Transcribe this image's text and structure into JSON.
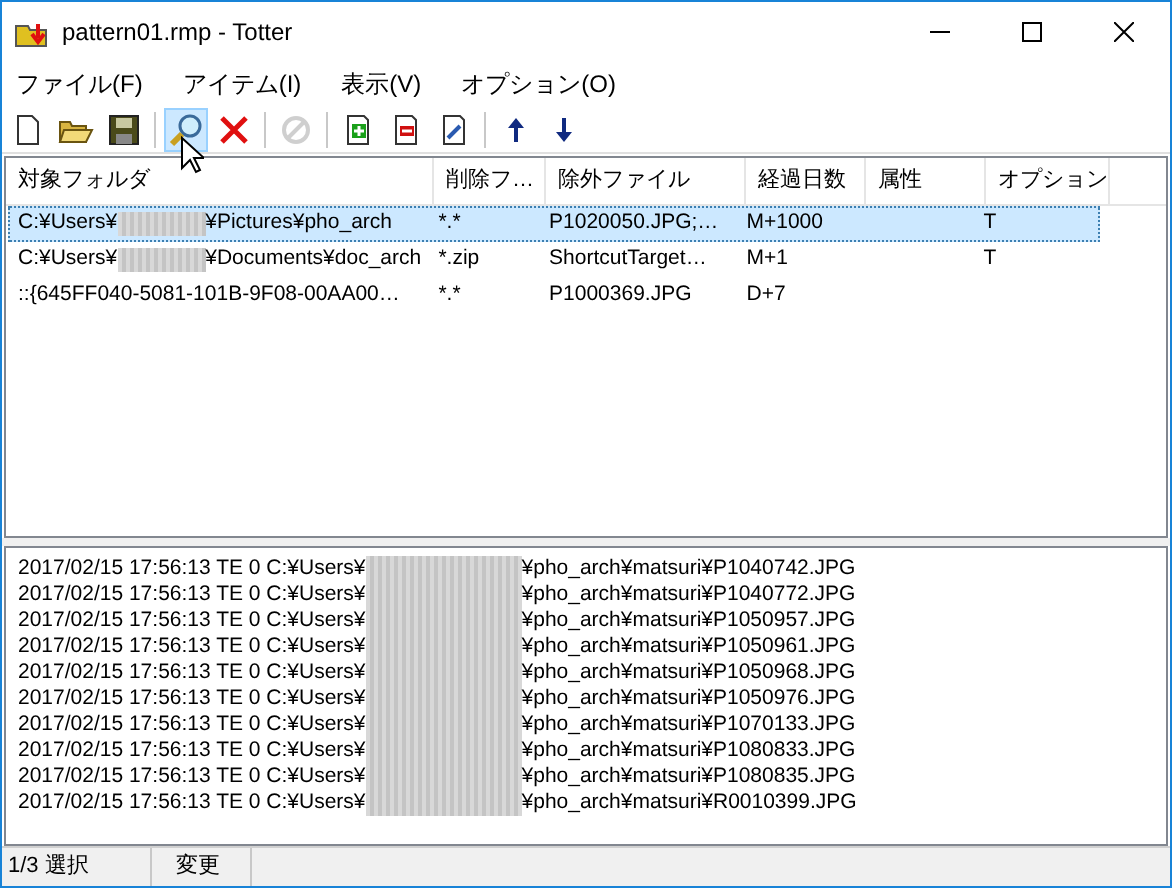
{
  "window": {
    "title": "pattern01.rmp - Totter"
  },
  "menu": [
    "ファイル(F)",
    "アイテム(I)",
    "表示(V)",
    "オプション(O)"
  ],
  "toolbar": [
    [
      {
        "kind": "new",
        "pressed": false,
        "disabled": false
      },
      {
        "kind": "open",
        "pressed": false,
        "disabled": false
      },
      {
        "kind": "save",
        "pressed": false,
        "disabled": false
      }
    ],
    [
      {
        "kind": "search",
        "pressed": true,
        "disabled": false
      },
      {
        "kind": "delete",
        "pressed": false,
        "disabled": false
      }
    ],
    [
      {
        "kind": "stop",
        "pressed": false,
        "disabled": true
      }
    ],
    [
      {
        "kind": "add",
        "pressed": false,
        "disabled": false
      },
      {
        "kind": "remove",
        "pressed": false,
        "disabled": false
      },
      {
        "kind": "edit",
        "pressed": false,
        "disabled": false
      }
    ],
    [
      {
        "kind": "up",
        "pressed": false,
        "disabled": false
      },
      {
        "kind": "down",
        "pressed": false,
        "disabled": false
      }
    ]
  ],
  "table": {
    "columns": [
      "対象フォルダ",
      "削除フ…",
      "除外ファイル",
      "経過日数",
      "属性",
      "オプション"
    ],
    "rows": [
      {
        "selected": true,
        "cells": [
          [
            "C:¥Users¥",
            "¥Pictures¥pho_arch"
          ],
          "*.*",
          "P1020050.JPG;…",
          "M+1000",
          "",
          "T"
        ]
      },
      {
        "selected": false,
        "cells": [
          [
            "C:¥Users¥",
            "¥Documents¥doc_arch"
          ],
          "*.zip",
          "ShortcutTarget…",
          "M+1",
          "",
          "T"
        ]
      },
      {
        "selected": false,
        "cells": [
          "::{645FF040-5081-101B-9F08-00AA00…",
          "*.*",
          "P1000369.JPG",
          "D+7",
          "",
          ""
        ]
      }
    ]
  },
  "log": [
    [
      "2017/02/15 17:56:13 TE 0 C:¥Users¥",
      "¥pho_arch¥matsuri¥P1040742.JPG"
    ],
    [
      "2017/02/15 17:56:13 TE 0 C:¥Users¥",
      "¥pho_arch¥matsuri¥P1040772.JPG"
    ],
    [
      "2017/02/15 17:56:13 TE 0 C:¥Users¥",
      "¥pho_arch¥matsuri¥P1050957.JPG"
    ],
    [
      "2017/02/15 17:56:13 TE 0 C:¥Users¥",
      "¥pho_arch¥matsuri¥P1050961.JPG"
    ],
    [
      "2017/02/15 17:56:13 TE 0 C:¥Users¥",
      "¥pho_arch¥matsuri¥P1050968.JPG"
    ],
    [
      "2017/02/15 17:56:13 TE 0 C:¥Users¥",
      "¥pho_arch¥matsuri¥P1050976.JPG"
    ],
    [
      "2017/02/15 17:56:13 TE 0 C:¥Users¥",
      "¥pho_arch¥matsuri¥P1070133.JPG"
    ],
    [
      "2017/02/15 17:56:13 TE 0 C:¥Users¥",
      "¥pho_arch¥matsuri¥P1080833.JPG"
    ],
    [
      "2017/02/15 17:56:13 TE 0 C:¥Users¥",
      "¥pho_arch¥matsuri¥P1080835.JPG"
    ],
    [
      "2017/02/15 17:56:13 TE 0 C:¥Users¥",
      "¥pho_arch¥matsuri¥R0010399.JPG"
    ]
  ],
  "status_bar": [
    "1/3 選択",
    "変更"
  ]
}
